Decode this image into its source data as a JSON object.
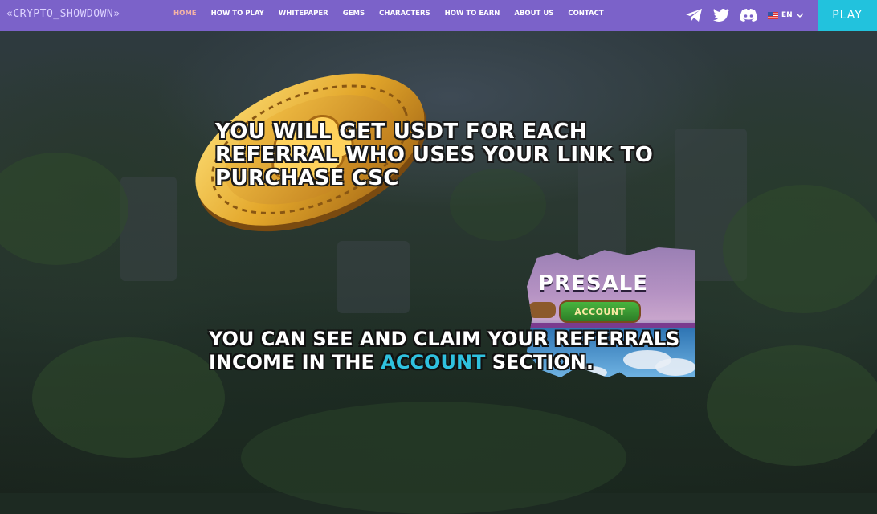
{
  "nav": {
    "logo": "«CRYPTO_SHOWDOWN»",
    "items": [
      {
        "label": "HOME",
        "active": true
      },
      {
        "label": "HOW TO PLAY"
      },
      {
        "label": "WHITEPAPER"
      },
      {
        "label": "GEMS"
      },
      {
        "label": "CHARACTERS"
      },
      {
        "label": "HOW TO EARN"
      },
      {
        "label": "ABOUT US"
      },
      {
        "label": "CONTACT"
      }
    ],
    "socials": [
      "telegram-icon",
      "twitter-icon",
      "discord-icon"
    ],
    "language": "EN",
    "play_label": "PLAY",
    "colors": {
      "bar": "#7b62c9",
      "active": "#f3b3a6",
      "play": "#22c2dd"
    }
  },
  "main": {
    "headline": "YOU WILL GET USDT FOR EACH REFERRAL WHO USES YOUR LINK TO PURCHASE CSC",
    "subline_before": "YOU CAN SEE AND CLAIM YOUR REFERRALS INCOME IN THE",
    "subline_highlight": "ACCOUNT",
    "subline_after": "SECTION.",
    "highlight_color": "#2fc1df"
  },
  "panel": {
    "title": "PRESALE",
    "button": "ACCOUNT"
  }
}
